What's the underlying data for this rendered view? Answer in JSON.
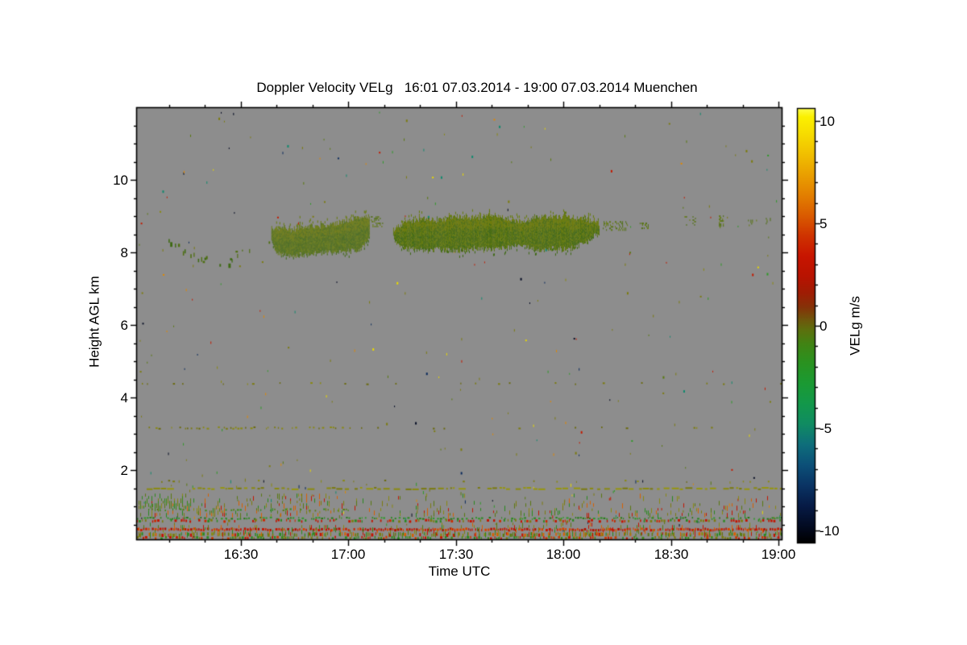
{
  "chart_data": {
    "type": "heatmap",
    "title": "Doppler Velocity VELg   16:01 07.03.2014 - 19:00 07.03.2014 Muenchen",
    "xlabel": "Time UTC",
    "ylabel": "Height AGL km",
    "x_range": [
      "16:01",
      "19:00"
    ],
    "x_ticks": [
      "16:30",
      "17:00",
      "17:30",
      "18:00",
      "18:30",
      "19:00"
    ],
    "x_minor_step_min": 10,
    "y_range_km": [
      0.09,
      11.98
    ],
    "y_ticks_km": [
      2,
      4,
      6,
      8,
      10
    ],
    "y_minor_step_km": 0.5,
    "grid": false,
    "background_nodata_color": "#8d8d8d",
    "colorbar": {
      "label": "VELg m/s",
      "ticks": [
        10,
        5,
        0,
        -5,
        -10
      ],
      "minor_step": 1,
      "range": [
        -10.6,
        10.6
      ],
      "stops": [
        [
          -10.6,
          "#000000"
        ],
        [
          -9.8,
          "#030b22"
        ],
        [
          -8.8,
          "#071b46"
        ],
        [
          -7.8,
          "#0a3464"
        ],
        [
          -6.8,
          "#0c5078"
        ],
        [
          -5.8,
          "#0e6e7b"
        ],
        [
          -4.8,
          "#108c62"
        ],
        [
          -3.8,
          "#13984a"
        ],
        [
          -2.8,
          "#1b9a33"
        ],
        [
          -1.8,
          "#2a9220"
        ],
        [
          -0.9,
          "#418414"
        ],
        [
          -0.2,
          "#5d700e"
        ],
        [
          0.3,
          "#6f560c"
        ],
        [
          0.9,
          "#853208"
        ],
        [
          1.6,
          "#9f1d04"
        ],
        [
          2.4,
          "#b81301"
        ],
        [
          3.4,
          "#c81500"
        ],
        [
          4.4,
          "#cf3300"
        ],
        [
          5.4,
          "#da5c00"
        ],
        [
          6.4,
          "#e38000"
        ],
        [
          7.4,
          "#eaa000"
        ],
        [
          8.4,
          "#f1c000"
        ],
        [
          9.4,
          "#f7dd00"
        ],
        [
          10.2,
          "#fbf000"
        ],
        [
          10.6,
          "#fdfd45"
        ]
      ]
    },
    "features": {
      "cloud_velocity_m_s": -0.5,
      "clouds": [
        {
          "name": "cloud-band-1",
          "profile": [
            [
              38.5,
              8.62,
              8.3
            ],
            [
              40,
              8.66,
              7.98
            ],
            [
              44,
              8.62,
              7.92
            ],
            [
              48,
              8.7,
              7.95
            ],
            [
              52,
              8.72,
              8.02
            ],
            [
              56,
              8.78,
              7.98
            ],
            [
              60,
              8.88,
              8.05
            ],
            [
              63,
              8.95,
              8.1
            ],
            [
              65.8,
              8.98,
              8.42
            ]
          ]
        },
        {
          "name": "cloud-band-2",
          "profile": [
            [
              72.5,
              8.62,
              8.42
            ],
            [
              75,
              8.8,
              8.15
            ],
            [
              80,
              8.92,
              8.06
            ],
            [
              85,
              8.88,
              8.1
            ],
            [
              90,
              9.0,
              8.06
            ],
            [
              95,
              8.95,
              8.12
            ],
            [
              100,
              9.02,
              8.08
            ],
            [
              105,
              8.92,
              8.18
            ],
            [
              108,
              8.85,
              8.22
            ],
            [
              112,
              8.95,
              8.06
            ],
            [
              117,
              9.0,
              8.1
            ],
            [
              122,
              8.96,
              8.12
            ],
            [
              126,
              8.9,
              8.3
            ],
            [
              130,
              8.8,
              8.55
            ]
          ]
        }
      ],
      "cloud_colors": {
        "base": "#4f6f10",
        "v1": "#667d0c",
        "v2": "#3f6a14",
        "v3": "#59750e",
        "v4": "#6e7c08"
      },
      "trail": {
        "density": 0.35,
        "sigma_km": 0.1,
        "points": [
          [
            8.9,
            8.42
          ],
          [
            12,
            8.25
          ],
          [
            15,
            8.05
          ],
          [
            18,
            7.92
          ],
          [
            21,
            7.78
          ],
          [
            24,
            7.7
          ],
          [
            26.5,
            7.78
          ],
          [
            28.5,
            7.95
          ],
          [
            30.5,
            8.08
          ],
          [
            33,
            8.18
          ],
          [
            35.5,
            8.28
          ],
          [
            38,
            8.4
          ]
        ]
      },
      "clusters": [
        {
          "t": [
            66.3,
            69.8
          ],
          "km": [
            8.72,
            9.0
          ],
          "density": 0.5
        },
        {
          "t": [
            131,
            137.8
          ],
          "km": [
            8.6,
            8.86
          ],
          "density": 0.45
        },
        {
          "t": [
            141.3,
            143.8
          ],
          "km": [
            8.68,
            8.82
          ],
          "density": 0.35
        },
        {
          "t": [
            153.8,
            156.8
          ],
          "km": [
            8.75,
            9.0
          ],
          "density": 0.35
        },
        {
          "t": [
            163.4,
            164.6
          ],
          "km": [
            8.7,
            9.02
          ],
          "density": 0.9
        },
        {
          "t": [
            171.3,
            173.8
          ],
          "km": [
            8.75,
            8.9
          ],
          "density": 0.35
        },
        {
          "t": [
            176.5,
            178.0
          ],
          "km": [
            8.8,
            8.95
          ],
          "density": 0.3
        }
      ],
      "layers": [
        {
          "km": 4.38,
          "th": 2,
          "d": 0.08,
          "pal": "olive"
        },
        {
          "km": 3.16,
          "th": 2,
          "d": 0.26,
          "t": [
            2,
            64
          ],
          "pal": "olive"
        },
        {
          "km": 3.16,
          "th": 2,
          "d": 0.05,
          "t": [
            64,
            180
          ],
          "pal": "olive"
        },
        {
          "km": 1.69,
          "th": 2,
          "d": 0.05,
          "pal": "olive"
        },
        {
          "km": 1.49,
          "th": 2,
          "d": 0.4,
          "pal": "olive2",
          "dash": true
        },
        {
          "km": 0.9,
          "th": 2,
          "d": 0.22,
          "t": [
            1,
            60
          ],
          "pal": "grol"
        },
        {
          "km": 0.67,
          "th": 2,
          "d": 0.5,
          "pal": "green"
        },
        {
          "km": 0.6,
          "th": 3,
          "d": 0.42,
          "pal": "redgreen"
        },
        {
          "km": 0.36,
          "th": 3,
          "d": 0.85,
          "pal": "red"
        },
        {
          "km": 0.22,
          "th": 4,
          "d": 0.45,
          "pal": "mix"
        },
        {
          "km": 0.13,
          "th": 3,
          "d": 0.5,
          "pal": "mix2"
        }
      ],
      "bands": [
        {
          "km": [
            0.75,
            1.35
          ],
          "d": 0.07,
          "pal": "mix",
          "boost_t": [
            1,
            55
          ],
          "boost": 2.2
        },
        {
          "km": [
            0.42,
            0.55
          ],
          "d": 0.12,
          "pal": "mix"
        },
        {
          "km": [
            0.95,
            1.35
          ],
          "d": 0.3,
          "t": [
            1,
            16
          ],
          "pal": "grol"
        },
        {
          "km": [
            0.28,
            0.42
          ],
          "d": 0.2,
          "pal": "mix"
        }
      ],
      "palettes": {
        "olive": [
          "#7c7c10",
          "#8a8a10",
          "#6b6b0e"
        ],
        "olive2": [
          "#8a8a10",
          "#96960f",
          "#7a7a0e"
        ],
        "grol": [
          "#3f8a14",
          "#5a7a10",
          "#2f8a1e"
        ],
        "green": [
          "#2a8a1e",
          "#2f9a28",
          "#237a14"
        ],
        "red": [
          "#c41400",
          "#cc2200",
          "#b21000",
          "#d84400"
        ],
        "redgreen": [
          "#c41400",
          "#2a8a1e",
          "#7c7c10",
          "#cc2a00",
          "#c41400"
        ],
        "mix": [
          "#7c7c10",
          "#c41400",
          "#2a8a1e",
          "#d86000",
          "#5a7a10",
          "#8a8a10"
        ],
        "mix2": [
          "#2a8a1e",
          "#c41400",
          "#7c7c10",
          "#3f8a14",
          "#cc3a00"
        ]
      },
      "noise": {
        "upper_count": 230,
        "lower_count": 130,
        "palette": [
          [
            "#7c7c10",
            0.26
          ],
          [
            "#5a7a10",
            0.12
          ],
          [
            "#2f9a28",
            0.12
          ],
          [
            "#128a6e",
            0.08
          ],
          [
            "#e08800",
            0.09
          ],
          [
            "#c41a00",
            0.1
          ],
          [
            "#e8d800",
            0.05
          ],
          [
            "#060d24",
            0.07
          ],
          [
            "#0a2a5c",
            0.05
          ],
          [
            "#8a8a10",
            0.06
          ]
        ]
      }
    }
  }
}
